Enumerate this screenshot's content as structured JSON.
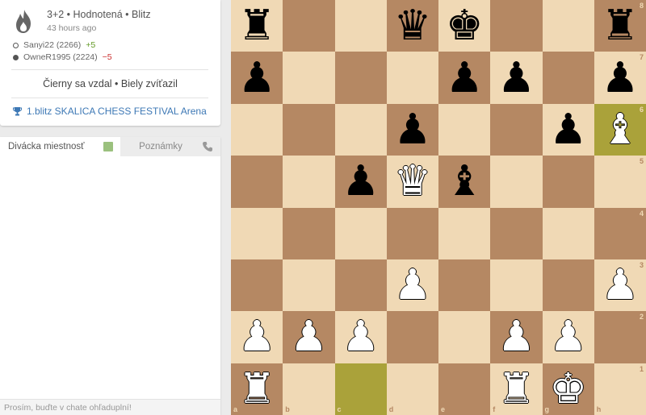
{
  "game": {
    "icon": "blitz-flame-icon",
    "title": "3+2 • Hodnotená • Blitz",
    "time_ago": "43 hours ago",
    "players": [
      {
        "color": "white",
        "name": "Sanyi22 (2266)",
        "rating_change": "+5"
      },
      {
        "color": "black",
        "name": "OwneR1995 (2224)",
        "rating_change": "−5"
      }
    ],
    "result": "Čierny sa vzdal • Biely zvíťazil",
    "tournament": {
      "icon": "trophy-icon",
      "name": "1.blitz SKALICA CHESS FESTIVAL Arena"
    }
  },
  "chat": {
    "tab_spectator": "Divácka miestnosť",
    "tab_notes": "Poznámky",
    "input_placeholder": "Prosím, buďte v chate ohľaduplní!"
  },
  "colors": {
    "light_square": "#f0d9b5",
    "dark_square": "#b58863",
    "highlight": "#aaa23a",
    "link": "#3d78b5"
  },
  "board": {
    "ranks": [
      [
        "r",
        "",
        "",
        "q",
        "k",
        "",
        "",
        "r"
      ],
      [
        "p",
        "",
        "",
        "",
        "p",
        "p",
        "",
        "p"
      ],
      [
        "",
        "",
        "",
        "p",
        "",
        "",
        "p",
        "B"
      ],
      [
        "",
        "",
        "p",
        "Q",
        "b",
        "",
        "",
        ""
      ],
      [
        "",
        "",
        "",
        "",
        "",
        "",
        "",
        ""
      ],
      [
        "",
        "",
        "",
        "P",
        "",
        "",
        "",
        "P"
      ],
      [
        "P",
        "P",
        "P",
        "",
        "",
        "P",
        "P",
        ""
      ],
      [
        "R",
        "",
        "",
        "",
        "",
        "R",
        "K",
        ""
      ]
    ],
    "highlighted": [
      "h6",
      "c1"
    ],
    "files": [
      "a",
      "b",
      "c",
      "d",
      "e",
      "f",
      "g",
      "h"
    ],
    "rank_labels": [
      "8",
      "7",
      "6",
      "5",
      "4",
      "3",
      "2",
      "1"
    ]
  }
}
